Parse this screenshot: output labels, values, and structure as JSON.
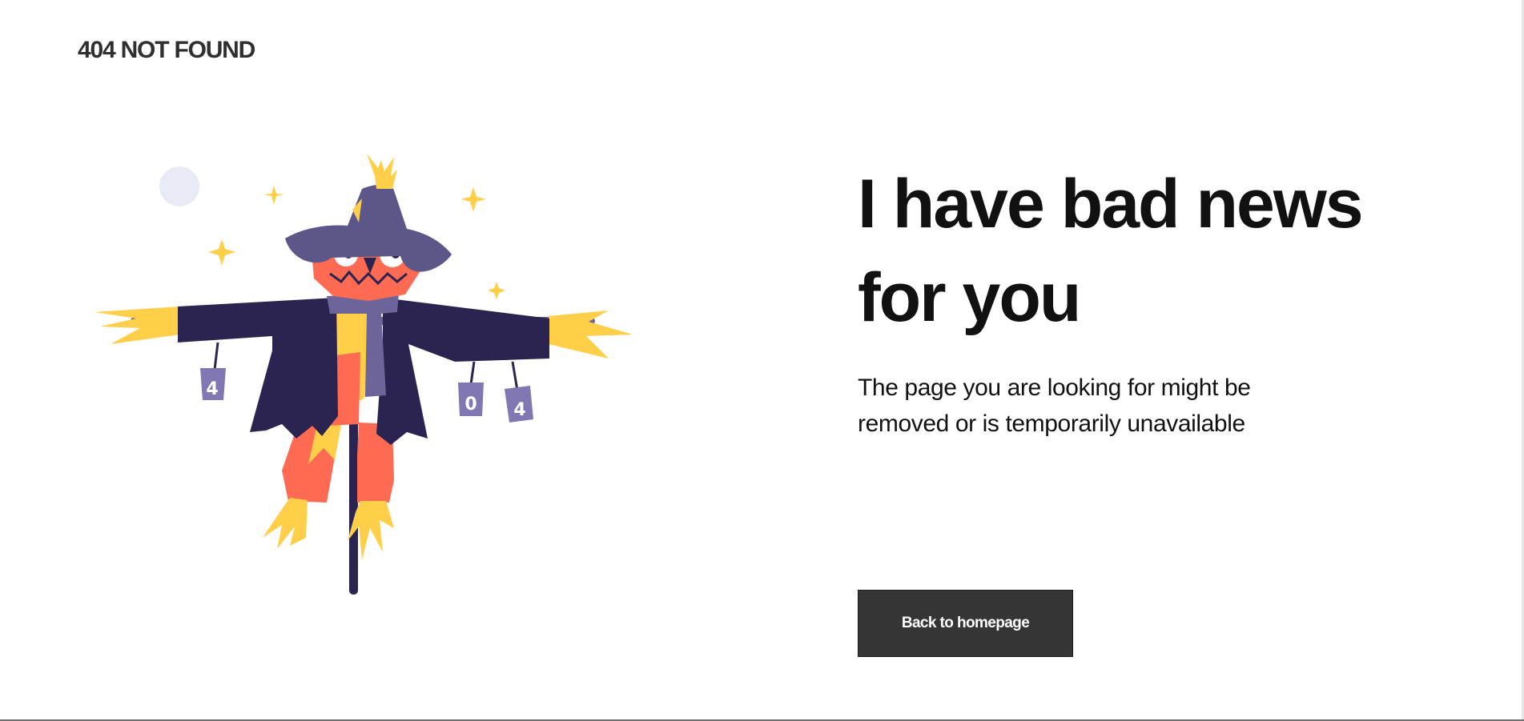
{
  "header": {
    "brand": "404 NOT FOUND"
  },
  "main": {
    "headline": "I have bad news for you",
    "message": "The page you are looking for might be removed or is temporarily unavailable",
    "button_label": "Back to homepage"
  },
  "illustration": {
    "subject": "scarecrow",
    "can_labels": [
      "4",
      "0",
      "4"
    ]
  },
  "colors": {
    "text_primary": "#111111",
    "brand_text": "#2f2f2f",
    "button_bg": "#353535",
    "button_text": "#ffffff",
    "scarecrow_coat": "#2b2450",
    "scarecrow_hat": "#5d5789",
    "scarecrow_skin": "#ff6b52",
    "straw": "#ffcf4a",
    "scarf": "#6d6499",
    "moon": "#e8ebf5"
  }
}
